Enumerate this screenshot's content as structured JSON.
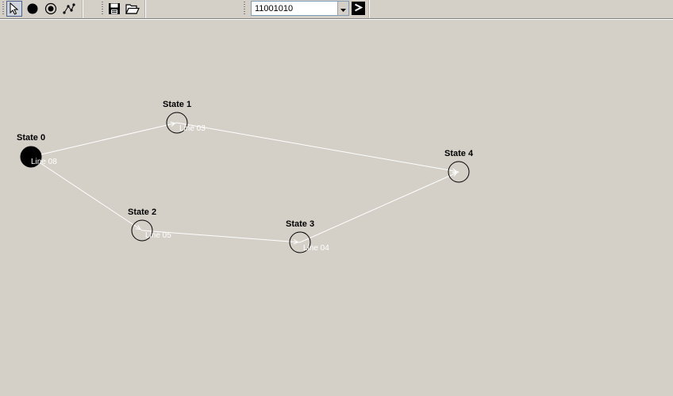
{
  "toolbar": {
    "tools": [
      {
        "name": "select-tool",
        "icon": "arrow-cursor-icon",
        "active": true
      },
      {
        "name": "state-tool",
        "icon": "filled-circle-icon",
        "active": false
      },
      {
        "name": "final-state-tool",
        "icon": "double-circle-icon",
        "active": false
      },
      {
        "name": "transition-tool",
        "icon": "transition-line-icon",
        "active": false
      }
    ],
    "file_actions": [
      {
        "name": "save-button",
        "icon": "floppy-disk-icon"
      },
      {
        "name": "open-button",
        "icon": "folder-open-icon"
      }
    ],
    "input_value": "11001010",
    "run_button_icon": "play-arrow-icon"
  },
  "diagram": {
    "states": [
      {
        "id": "s0",
        "label": "State 0",
        "initial": true
      },
      {
        "id": "s1",
        "label": "State 1",
        "initial": false
      },
      {
        "id": "s2",
        "label": "State 2",
        "initial": false
      },
      {
        "id": "s3",
        "label": "State 3",
        "initial": false
      },
      {
        "id": "s4",
        "label": "State 4",
        "initial": false
      }
    ],
    "transitions": [
      {
        "from": "s0",
        "to": "s1",
        "label": ""
      },
      {
        "from": "s1",
        "to": "s4",
        "label": "Line 03"
      },
      {
        "from": "s0",
        "to": "s2",
        "label": "Line 08"
      },
      {
        "from": "s2",
        "to": "s3",
        "label": "Line 05"
      },
      {
        "from": "s3",
        "to": "s4",
        "label": "Line 04"
      }
    ],
    "colors": {
      "background": "#d4d0c8",
      "state_stroke": "#000000",
      "initial_fill": "#000000",
      "edge": "#ffffff",
      "edge_label": "#ffffff"
    }
  }
}
